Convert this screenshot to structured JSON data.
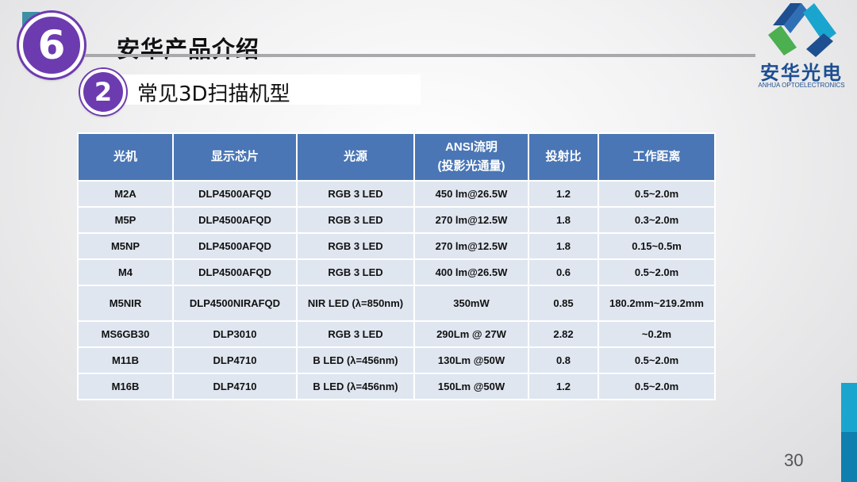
{
  "section": {
    "number": "6",
    "title": "安华产品介绍"
  },
  "subsection": {
    "number": "2",
    "title": "常见3D扫描机型"
  },
  "logo": {
    "name_cn": "安华光电",
    "name_en": "ANHUA OPTOELECTRONICS",
    "colors": [
      "#1d4f91",
      "#4caf50",
      "#1aa5cf"
    ]
  },
  "table": {
    "headers": [
      "光机",
      "显示芯片",
      "光源",
      "ANSI流明",
      "(投影光通量)",
      "投射比",
      "工作距离"
    ],
    "rows": [
      [
        "M2A",
        "DLP4500AFQD",
        "RGB 3 LED",
        "450 lm@26.5W",
        "1.2",
        "0.5~2.0m"
      ],
      [
        "M5P",
        "DLP4500AFQD",
        "RGB 3 LED",
        "270 lm@12.5W",
        "1.8",
        "0.3~2.0m"
      ],
      [
        "M5NP",
        "DLP4500AFQD",
        "RGB 3 LED",
        "270 lm@12.5W",
        "1.8",
        "0.15~0.5m"
      ],
      [
        "M4",
        "DLP4500AFQD",
        "RGB 3 LED",
        "400 lm@26.5W",
        "0.6",
        "0.5~2.0m"
      ],
      [
        "M5NIR",
        "DLP4500NIRAFQD",
        "NIR LED (λ=850nm)",
        "350mW",
        "0.85",
        "180.2mm~219.2mm"
      ],
      [
        "MS6GB30",
        "DLP3010",
        "RGB 3 LED",
        "290Lm @ 27W",
        "2.82",
        "~0.2m"
      ],
      [
        "M11B",
        "DLP4710",
        "B LED (λ=456nm)",
        "130Lm @50W",
        "0.8",
        "0.5~2.0m"
      ],
      [
        "M16B",
        "DLP4710",
        "B LED (λ=456nm)",
        "150Lm @50W",
        "1.2",
        "0.5~2.0m"
      ]
    ]
  },
  "page_number": "30",
  "colors": {
    "accent_purple": "#6d3bb0",
    "header_blue": "#4a76b5",
    "cell_bg": "#dfe6f0",
    "side_bar": "#1aa5cf"
  }
}
